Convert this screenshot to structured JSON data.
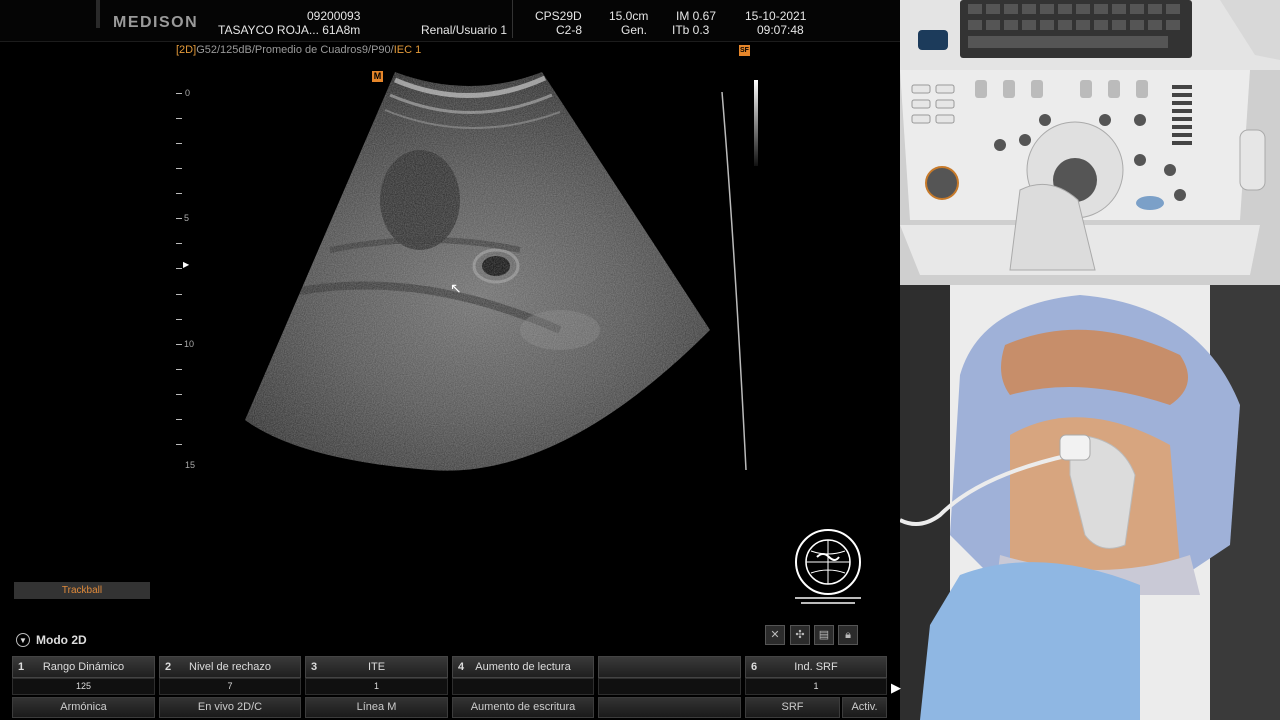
{
  "header": {
    "brand": "MEDISON",
    "patient_id": "09200093",
    "patient_name": "TASAYCO ROJA... 61A8m",
    "study": "Renal/Usuario 1",
    "probe_model": "CPS29D",
    "probe_type": "C2-8",
    "depth": "15.0cm",
    "freq": "Gen.",
    "mi": "IM 0.67",
    "tib": "ITb 0.3",
    "date": "15-10-2021",
    "time": "09:07:48"
  },
  "image_params": {
    "mode_tag": "[2D]",
    "text": "G52/125dB/Promedio de Cuadros9/P90/",
    "iec": "IEC 1"
  },
  "markers": {
    "focus_marker": "M",
    "orientation_marker": "SF"
  },
  "depth_scale": [
    "0",
    "5",
    "10",
    "15"
  ],
  "trackball_label": "Trackball",
  "mode_label": "Modo 2D",
  "softkeys": [
    {
      "num": "1",
      "label": "Rango Dinámico",
      "value": "125"
    },
    {
      "num": "2",
      "label": "Nivel de rechazo",
      "value": "7"
    },
    {
      "num": "3",
      "label": "ITE",
      "value": "1"
    },
    {
      "num": "4",
      "label": "Aumento de lectura",
      "value": ""
    },
    {
      "num": "",
      "label": "",
      "value": ""
    },
    {
      "num": "6",
      "label": "Ind. SRF",
      "value": "1"
    }
  ],
  "bottom_buttons": [
    "Armónica",
    "En vivo 2D/C",
    "Línea M",
    "Aumento de escritura",
    "",
    "SRF",
    "Activ."
  ],
  "colors": {
    "accent_orange": "#e6862a",
    "bg": "#000000"
  }
}
